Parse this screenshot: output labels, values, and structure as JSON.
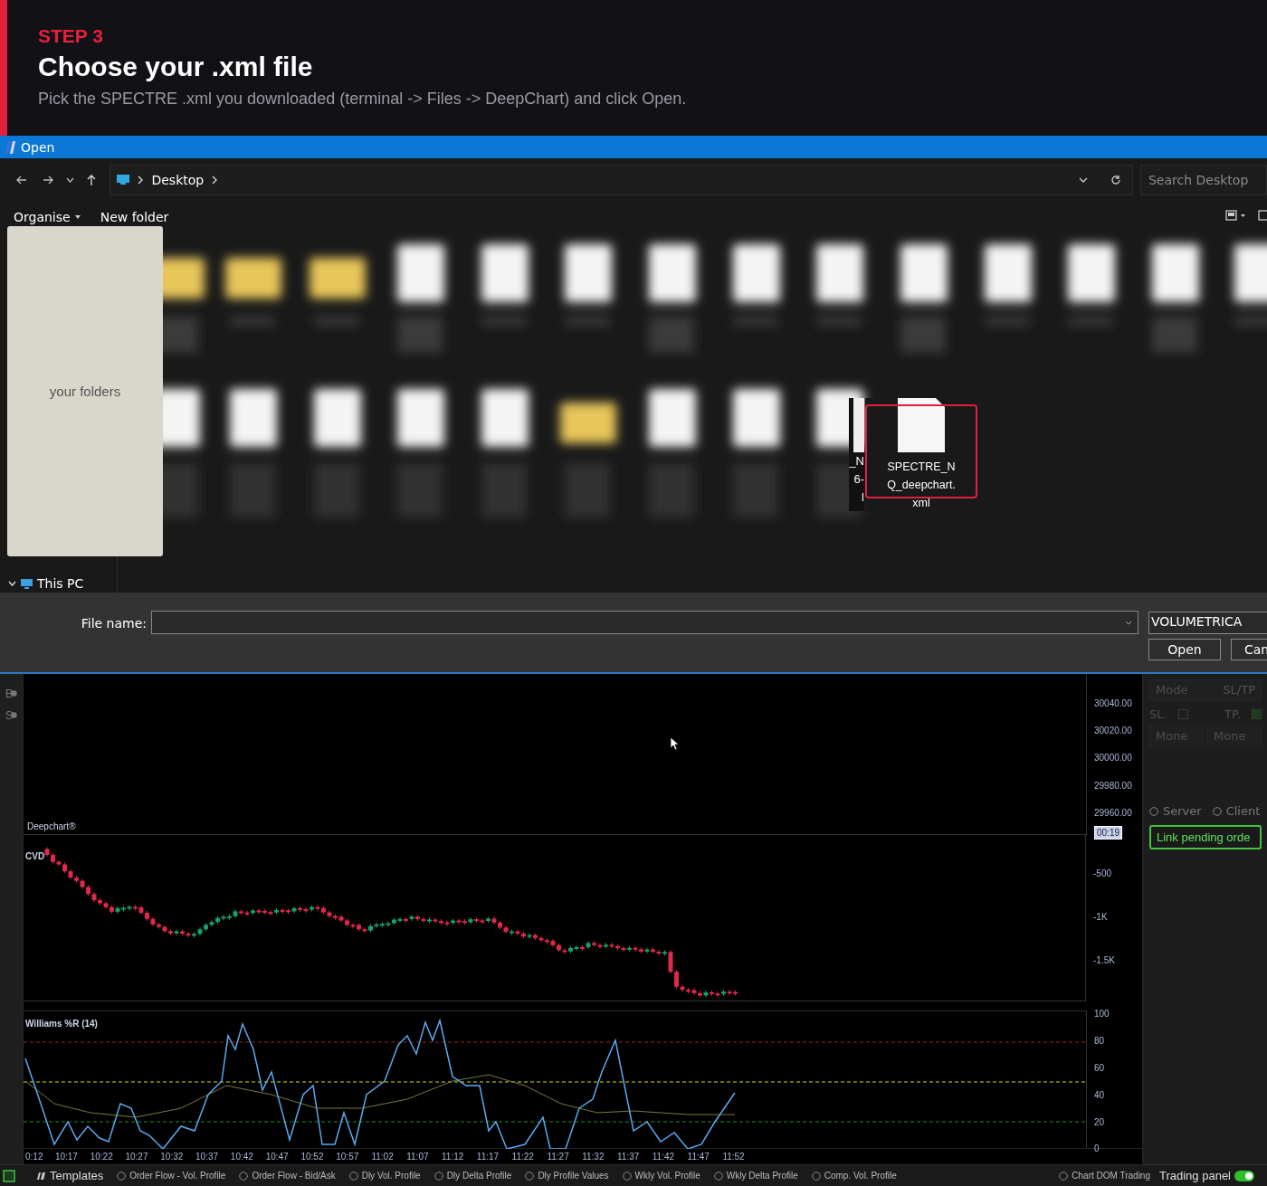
{
  "step": {
    "label": "STEP 3",
    "title": "Choose your .xml file",
    "description": "Pick the SPECTRE .xml you downloaded (terminal -> Files -> DeepChart) and click Open."
  },
  "dialog": {
    "title": "Open",
    "address": {
      "path": [
        "Desktop"
      ]
    },
    "search": {
      "placeholder": "Search Desktop"
    },
    "commands": [
      {
        "label": "Organise",
        "dropdown": true
      },
      {
        "label": "New folder",
        "dropdown": false
      }
    ],
    "overlay_note": "your folders",
    "nav_tree": [
      {
        "label": "This PC",
        "expanded": true
      }
    ],
    "partial_file_text": [
      "_N",
      "6-",
      "l"
    ],
    "highlighted_file": {
      "name": "SPECTRE_NQ_deepchart.xml",
      "highlighted": true
    },
    "file_name": {
      "label": "File name:"
    },
    "file_type": "VOLUMETRICA",
    "buttons": [
      "Open",
      "Can"
    ]
  },
  "trading": {
    "side_tools": [
      "B",
      "S"
    ],
    "price_chart": {
      "label": "Deepchart®",
      "ticks": [
        "30040.00",
        "30020.00",
        "30000.00",
        "29980.00",
        "29960.00"
      ],
      "time_badge": "00:19"
    },
    "cvd": {
      "label": "CVD",
      "ticks": [
        "-500",
        "-1K",
        "-1.5K"
      ]
    },
    "williams": {
      "label": "Williams %R (14)",
      "ticks": [
        "100",
        "80",
        "60",
        "40",
        "20",
        "0"
      ]
    },
    "time_axis": [
      "0:12",
      "10:17",
      "10:22",
      "10:27",
      "10:32",
      "10:37",
      "10:42",
      "10:47",
      "10:52",
      "10:57",
      "11:02",
      "11:07",
      "11:12",
      "11:17",
      "11:22",
      "11:27",
      "11:32",
      "11:37",
      "11:42",
      "11:47",
      "11:52"
    ],
    "panel": {
      "mode": {
        "label": "Mode",
        "value": "SL/TP"
      },
      "checks": [
        {
          "label": "SL.",
          "checked": false
        },
        {
          "label": "TP.",
          "checked": true
        }
      ],
      "selects": [
        "Mone",
        "Mone"
      ],
      "radios": [
        {
          "label": "Server",
          "selected": false
        },
        {
          "label": "Client",
          "selected": false
        }
      ],
      "link_button": "Link pending orde"
    },
    "bottom_bar": {
      "templates": "Templates",
      "items": [
        {
          "label": "Order Flow - Vol. Profile",
          "selected": false
        },
        {
          "label": "Order Flow - Bid/Ask",
          "selected": false
        },
        {
          "label": "Dly Vol. Profile",
          "selected": false
        },
        {
          "label": "Dly Delta Profile",
          "selected": false
        },
        {
          "label": "Dly Profile Values",
          "selected": false
        },
        {
          "label": "Wkly Vol. Profile",
          "selected": false
        },
        {
          "label": "Wkly Delta Profile",
          "selected": false
        },
        {
          "label": "Comp. Vol. Profile",
          "selected": false
        }
      ],
      "chart_dom": {
        "label": "Chart DOM Trading",
        "selected": false
      },
      "trading_panel": {
        "label": "Trading panel",
        "on": true
      }
    }
  }
}
